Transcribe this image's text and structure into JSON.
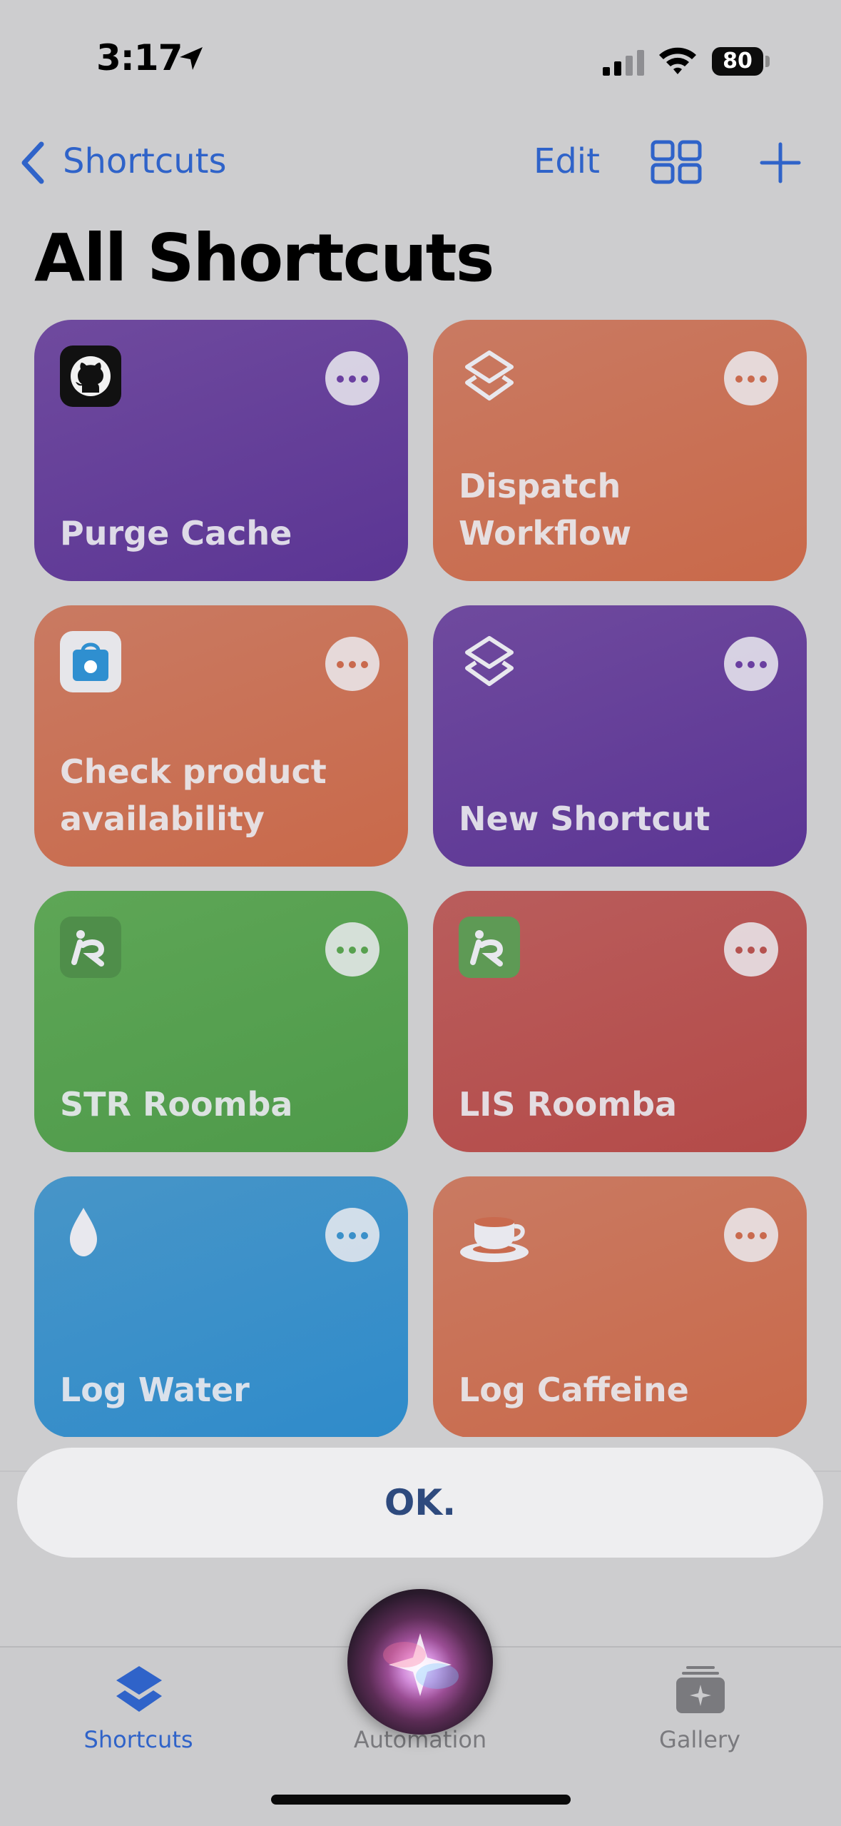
{
  "status_bar": {
    "time": "3:17",
    "battery": "80"
  },
  "nav": {
    "back_label": "Shortcuts",
    "edit_label": "Edit"
  },
  "page_title": "All Shortcuts",
  "shortcuts": [
    {
      "name": "Purge Cache",
      "color": "#6a3fa0",
      "icon": "github-icon"
    },
    {
      "name": "Dispatch Workflow",
      "color": "#c96a4e",
      "icon": "layers-icon"
    },
    {
      "name": "Check product availability",
      "color": "#c96a4e",
      "icon": "apple-store-icon"
    },
    {
      "name": "New Shortcut",
      "color": "#6a3fa0",
      "icon": "layers-icon"
    },
    {
      "name": "STR Roomba",
      "color": "#58a14f",
      "icon": "irobot-icon"
    },
    {
      "name": "LIS Roomba",
      "color": "#b5524f",
      "icon": "irobot-icon"
    },
    {
      "name": "Log Water",
      "color": "#3b90c9",
      "icon": "water-drop-icon"
    },
    {
      "name": "Log Caffeine",
      "color": "#c96a4e",
      "icon": "coffee-cup-icon"
    }
  ],
  "siri": {
    "response": "OK."
  },
  "tabbar": {
    "shortcuts_label": "Shortcuts",
    "automation_label": "Automation",
    "gallery_label": "Gallery"
  },
  "colors": {
    "accent": "#2f63c9",
    "background": "#cdcdcf"
  }
}
